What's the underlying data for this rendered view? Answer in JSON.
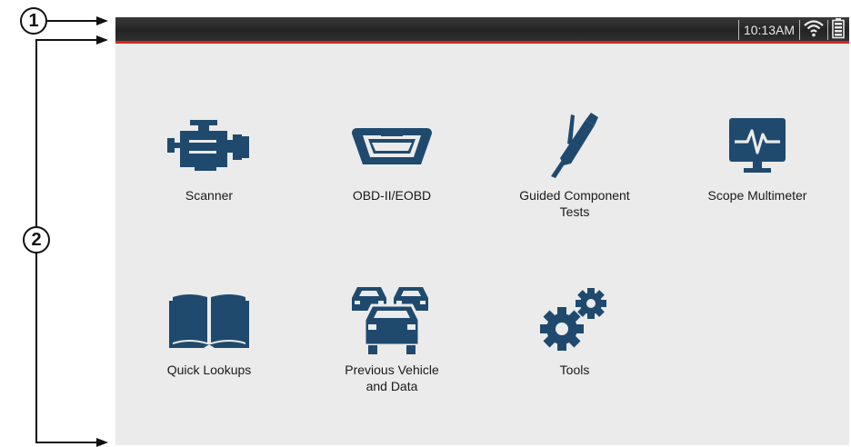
{
  "callouts": {
    "one": "1",
    "two": "2"
  },
  "status_bar": {
    "time": "10:13AM",
    "wifi_icon": "wifi-icon",
    "battery_icon": "battery-icon"
  },
  "apps": [
    {
      "label": "Scanner",
      "icon": "engine-icon"
    },
    {
      "label": "OBD-II/EOBD",
      "icon": "obd-connector-icon"
    },
    {
      "label": "Guided Component\nTests",
      "icon": "test-probe-icon"
    },
    {
      "label": "Scope Multimeter",
      "icon": "scope-monitor-icon"
    },
    {
      "label": "Quick Lookups",
      "icon": "book-icon"
    },
    {
      "label": "Previous Vehicle\nand Data",
      "icon": "vehicles-icon"
    },
    {
      "label": "Tools",
      "icon": "gears-icon"
    }
  ],
  "colors": {
    "icon": "#1f4a6e",
    "status_bar": "#2b2b2b",
    "status_bar_accent": "#d22626",
    "screen_background": "#ebebeb"
  }
}
